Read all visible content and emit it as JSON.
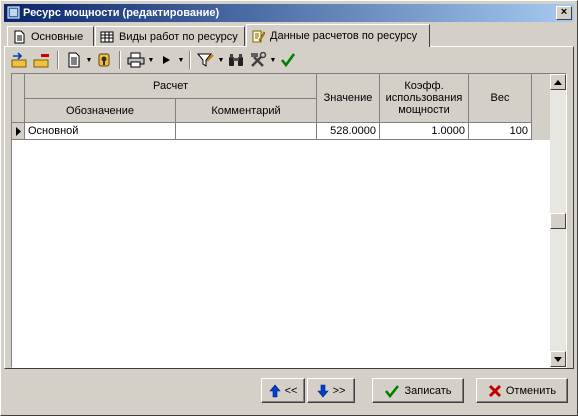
{
  "window": {
    "title": "Ресурс мощности (редактирование)",
    "close_label": "×"
  },
  "tabs": [
    {
      "label": "Основные",
      "icon": "document-icon"
    },
    {
      "label": "Виды работ по ресурсу",
      "icon": "table-icon"
    },
    {
      "label": "Данные расчетов по ресурсу",
      "icon": "edit-document-icon",
      "active": true
    }
  ],
  "toolbar": {
    "icons": [
      "add-record-icon",
      "delete-record-icon",
      "document-icon",
      "lookup-icon",
      "print-icon",
      "run-icon",
      "filter-icon",
      "binoculars-icon",
      "tools-icon",
      "checkmark-icon"
    ]
  },
  "grid": {
    "group_header": "Расчет",
    "columns": {
      "designation": "Обозначение",
      "comment": "Комментарий",
      "value": "Значение",
      "coef": "Коэфф. использования мощности",
      "weight": "Вес"
    },
    "rows": [
      {
        "designation": "Основной",
        "comment": "",
        "value": "528.0000",
        "coef": "1.0000",
        "weight": "100",
        "current": true
      }
    ]
  },
  "buttons": {
    "prev_label": "<<",
    "next_label": ">>",
    "save_label": "Записать",
    "cancel_label": "Отменить"
  },
  "colors": {
    "titlebar_start": "#0a246a",
    "titlebar_end": "#a6caf0",
    "face": "#d4d0c8"
  }
}
